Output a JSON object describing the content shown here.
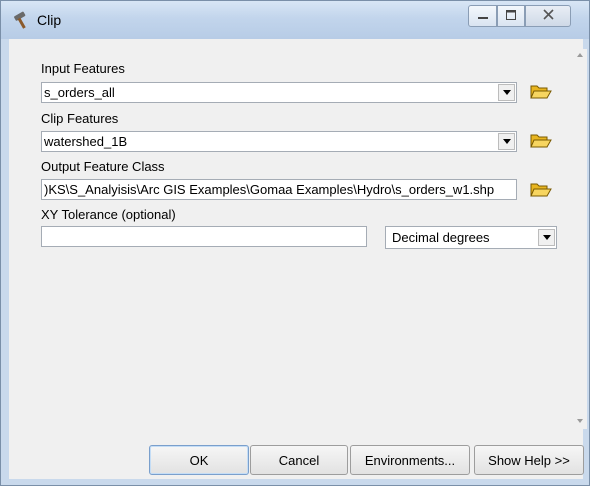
{
  "window": {
    "title": "Clip",
    "title_icon": "hammer-icon",
    "controls": {
      "minimize": "minimize-icon",
      "maximize": "maximize-icon",
      "close": "close-icon"
    }
  },
  "form": {
    "input_features": {
      "label": "Input Features",
      "value": "s_orders_all"
    },
    "clip_features": {
      "label": "Clip Features",
      "value": "watershed_1B"
    },
    "output_feature_class": {
      "label": "Output Feature Class",
      "value": ")KS\\S_Analyisis\\Arc GIS Examples\\Gomaa Examples\\Hydro\\s_orders_w1.shp"
    },
    "xy_tolerance": {
      "label": "XY Tolerance (optional)",
      "value": "",
      "unit": "Decimal degrees"
    }
  },
  "buttons": {
    "ok": "OK",
    "cancel": "Cancel",
    "environments": "Environments...",
    "show_help": "Show Help >>"
  },
  "colors": {
    "titlebar": "#c2d5ec",
    "client_bg": "#f0f0f0",
    "folder_icon": "#e8b520"
  }
}
